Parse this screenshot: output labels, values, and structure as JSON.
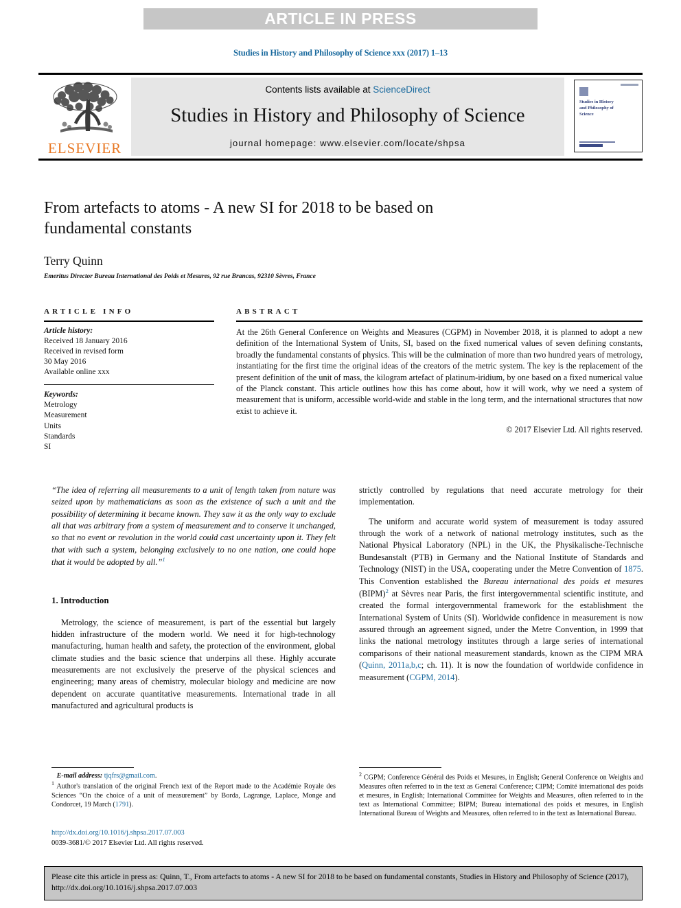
{
  "banner": {
    "label": "ARTICLE IN PRESS"
  },
  "running_head": "Studies in History and Philosophy of Science xxx (2017) 1–13",
  "masthead": {
    "publisher": "ELSEVIER",
    "contents_prefix": "Contents lists available at ",
    "contents_link": "ScienceDirect",
    "journal_title": "Studies in History and Philosophy of Science",
    "homepage": "journal homepage: www.elsevier.com/locate/shpsa",
    "cover_title": "Studies in History and Philosophy of Science"
  },
  "article": {
    "title": "From artefacts to atoms - A new SI for 2018 to be based on fundamental constants",
    "author": "Terry Quinn",
    "affiliation": "Emeritus Director Bureau International des Poids et Mesures, 92 rue Brancas, 92310 Sèvres, France"
  },
  "info": {
    "heading": "ARTICLE INFO",
    "history_label": "Article history:",
    "history_lines": [
      "Received 18 January 2016",
      "Received in revised form",
      "30 May 2016",
      "Available online xxx"
    ],
    "keywords_label": "Keywords:",
    "keywords": [
      "Metrology",
      "Measurement",
      "Units",
      "Standards",
      "SI"
    ]
  },
  "abstract": {
    "heading": "ABSTRACT",
    "text": "At the 26th General Conference on Weights and Measures (CGPM) in November 2018, it is planned to adopt a new definition of the International System of Units, SI, based on the fixed numerical values of seven defining constants, broadly the fundamental constants of physics. This will be the culmination of more than two hundred years of metrology, instantiating for the first time the original ideas of the creators of the metric system. The key is the replacement of the present definition of the unit of mass, the kilogram artefact of platinum-iridium, by one based on a fixed numerical value of the Planck constant. This article outlines how this has come about, how it will work, why we need a system of measurement that is uniform, accessible world-wide and stable in the long term, and the international structures that now exist to achieve it.",
    "rights": "© 2017 Elsevier Ltd. All rights reserved."
  },
  "body": {
    "quote": "“The idea of referring all measurements to a unit of length taken from nature was seized upon by mathematicians as soon as the existence of such a unit and the possibility of determining it became known. They saw it as the only way to exclude all that was arbitrary from a system of measurement and to conserve it unchanged, so that no event or revolution in the world could cast uncertainty upon it. They felt that with such a system, belonging exclusively to no one nation, one could hope that it would be adopted by all.”",
    "quote_note": "1",
    "section_number_title": "1. Introduction",
    "intro_paragraph": "Metrology, the science of measurement, is part of the essential but largely hidden infrastructure of the modern world. We need it for high-technology manufacturing, human health and safety, the protection of the environment, global climate studies and the basic science that underpins all these. Highly accurate measurements are not exclusively the preserve of the physical sciences and engineering; many areas of chemistry, molecular biology and medicine are now dependent on accurate quantitative measurements. International trade in all manufactured and agricultural products is",
    "right_continuation": "strictly controlled by regulations that need accurate metrology for their implementation.",
    "right_paragraph_a": "The uniform and accurate world system of measurement is today assured through the work of a network of national metrology institutes, such as the National Physical Laboratory (NPL) in the UK, the Physikalische-Technische Bundesanstalt (PTB) in Germany and the National Institute of Standards and Technology (NIST) in the USA, cooperating under the Metre Convention of ",
    "right_link_1875": "1875",
    "right_paragraph_b": ". This Convention established the ",
    "right_italic_bipm": "Bureau international des poids et mesures",
    "right_paragraph_c": " (BIPM)",
    "right_note_2": "2",
    "right_paragraph_d": " at Sèvres near Paris, the first intergovernmental scientific institute, and created the formal intergovernmental framework for the establishment the International System of Units (SI). Worldwide confidence in measurement is now assured through an agreement signed, under the Metre Convention, in 1999 that links the national metrology institutes through a large series of international comparisons of their national measurement standards, known as the CIPM MRA (",
    "right_link_quinn": "Quinn, 2011a,b,c",
    "right_paragraph_e": "; ch. 11). It is now the foundation of worldwide confidence in measurement (",
    "right_link_cgpm": "CGPM, 2014",
    "right_paragraph_f": ")."
  },
  "footnotes": {
    "email_label": "E-mail address:",
    "email_value": "tjqfrs@gmail.com",
    "note1_marker": "1",
    "note1_text_a": " Author's translation of the original French text of the Report made to the Académie Royale des Sciences “On the choice of a unit of measurement” by Borda, Lagrange, Laplace, Monge and Condorcet, 19 March (",
    "note1_link": "1791",
    "note1_text_b": ").",
    "note2_marker": "2",
    "note2_text": " CGPM; Conference Général des Poids et Mesures, in English; General Conference on Weights and Measures often referred to in the text as General Conference; CIPM; Comité international des poids et mesures, in English; International Committee for Weights and Measures, often referred to in the text as International Committee; BIPM; Bureau international des poids et mesures, in English International Bureau of Weights and Measures, often referred to in the text as International Bureau.",
    "note2_italic_1": "Conference Général des Poids et Mesures",
    "note2_italic_2": "Comité international des poids et mesures",
    "note2_italic_3": "Bureau international des poids et mesures",
    "doi_url": "http://dx.doi.org/10.1016/j.shpsa.2017.07.003",
    "issn_line": "0039-3681/© 2017 Elsevier Ltd. All rights reserved."
  },
  "citation_footer": {
    "text": "Please cite this article in press as: Quinn, T., From artefacts to atoms - A new SI for 2018 to be based on fundamental constants, Studies in History and Philosophy of Science (2017), http://dx.doi.org/10.1016/j.shpsa.2017.07.003"
  },
  "colors": {
    "link": "#1a6a9e",
    "banner_bg": "#c6c6c6",
    "band_bg": "#e6e6e6",
    "elsevier_orange": "#e87722"
  }
}
